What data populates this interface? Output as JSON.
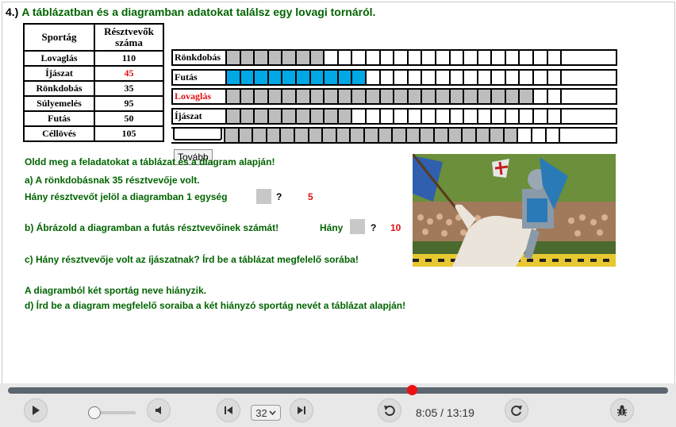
{
  "title": {
    "number": "4.)",
    "text": "A táblázatban és a diagramban adatokat találsz egy lovagi tornáról."
  },
  "table": {
    "headers": [
      "Sportág",
      "Résztvevők száma"
    ],
    "rows": [
      {
        "sport": "Lovaglás",
        "count": "110"
      },
      {
        "sport": "Íjászat",
        "count": "45"
      },
      {
        "sport": "Rönkdobás",
        "count": "35"
      },
      {
        "sport": "Súlyemelés",
        "count": "95"
      },
      {
        "sport": "Futás",
        "count": "50"
      },
      {
        "sport": "Céllövés",
        "count": "105"
      }
    ]
  },
  "diagram": {
    "unit": 5,
    "total_cells": 25,
    "colors": {
      "gray": "#bdbdbd",
      "blue": "#00a8e6",
      "red_text": "#e01010"
    },
    "rows": [
      {
        "label": "Rönkdobás",
        "filled": 7,
        "fill": "gray"
      },
      {
        "label": "Futás",
        "filled": 10,
        "fill": "blue"
      },
      {
        "label": "Lovaglás",
        "filled": 22,
        "fill": "gray"
      },
      {
        "label": "Íjászat",
        "filled": 9,
        "fill": "gray"
      },
      {
        "label": "",
        "filled": 21,
        "fill": "gray"
      }
    ]
  },
  "tovabb": "Tovább",
  "questions": {
    "intro": "Oldd meg a feladatokat a táblázat és a diagram alapján!",
    "a1": "a) A rönkdobásnak 35 résztvevője volt.",
    "a2": "Hány résztvevőt jelöl a diagramban 1 egység",
    "a_q": "?",
    "a_answer": "5",
    "b": "b) Ábrázold a diagramban a futás résztvevőinek számát!",
    "b_hany": "Hány",
    "b_q": "?",
    "b_answer": "10",
    "c": "c) Hány résztvevője volt az íjászatnak? Írd be a táblázat megfelelő sorába!",
    "d_intro": "A diagramból két sportág neve hiányzik.",
    "d": "d) Írd be a diagram megfelelő soraiba a két hiányzó sportág nevét a táblázat alapján!"
  },
  "player": {
    "position": 0.612,
    "speed": "32",
    "current_time": "8:05",
    "separator": "/",
    "total_time": "13:19",
    "icons": [
      "play-icon",
      "volume-icon",
      "skip-back-icon",
      "skip-forward-icon",
      "replay-icon",
      "refresh-icon",
      "bug-icon"
    ]
  }
}
